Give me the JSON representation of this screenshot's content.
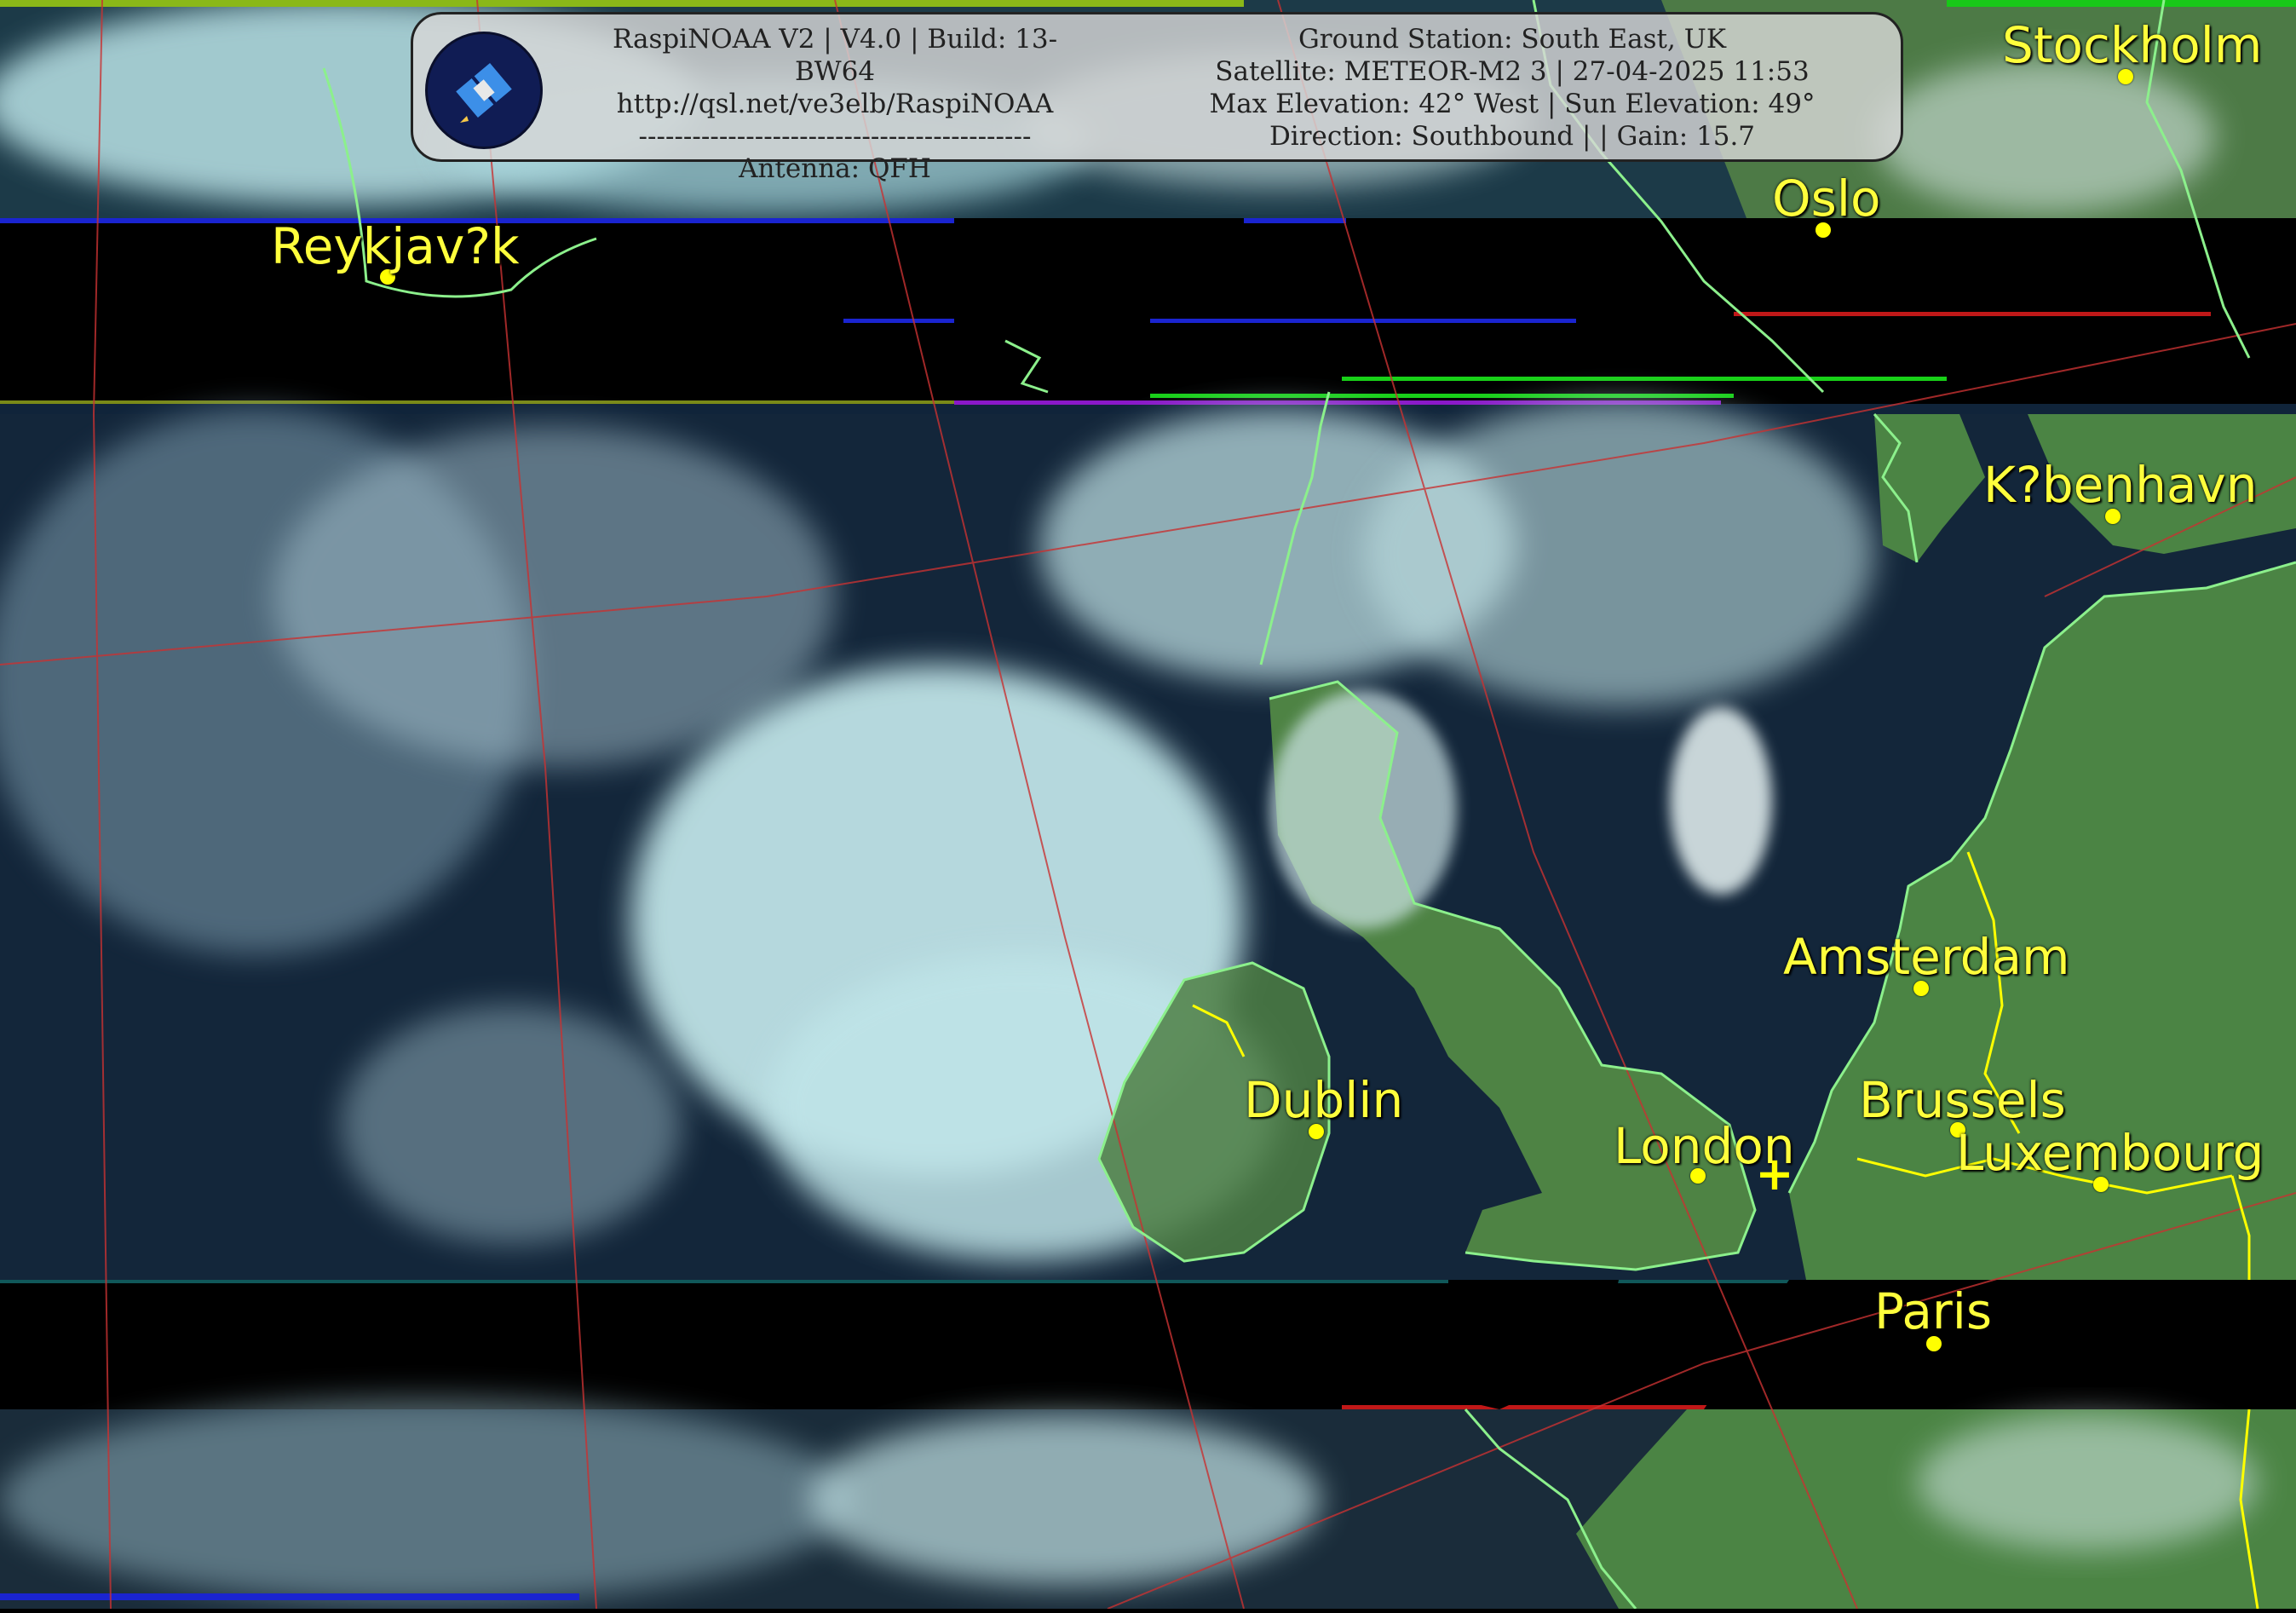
{
  "info_panel": {
    "left_lines": [
      "RaspiNOAA V2 | V4.0 | Build: 13-BW64",
      "http://qsl.net/ve3elb/RaspiNOAA",
      "--------------------------------------------",
      "Antenna: QFH"
    ],
    "right_lines": [
      "Ground Station: South East, UK",
      "Satellite: METEOR-M2 3 | 27-04-2025 11:53",
      "Max Elevation: 42° West | Sun Elevation: 49°",
      "Direction: Southbound | | Gain: 15.7"
    ],
    "logo_icon": "satellite-icon"
  },
  "cities": [
    {
      "name": "Stockholm"
    },
    {
      "name": "Oslo"
    },
    {
      "name": "Reykjav?k"
    },
    {
      "name": "K?benhavn"
    },
    {
      "name": "Amsterdam"
    },
    {
      "name": "Dublin"
    },
    {
      "name": "Brussels"
    },
    {
      "name": "London"
    },
    {
      "name": "Luxembourg"
    },
    {
      "name": "Paris"
    }
  ],
  "ground_station_marker": "+",
  "colors": {
    "city_label": "#ffff3c",
    "coastline": "#8cf08c",
    "border": "#ffff00",
    "graticule": "#c83232",
    "land": "#3f7a3a",
    "sea": "#0f2238",
    "cloud": "#c8e8ea"
  }
}
